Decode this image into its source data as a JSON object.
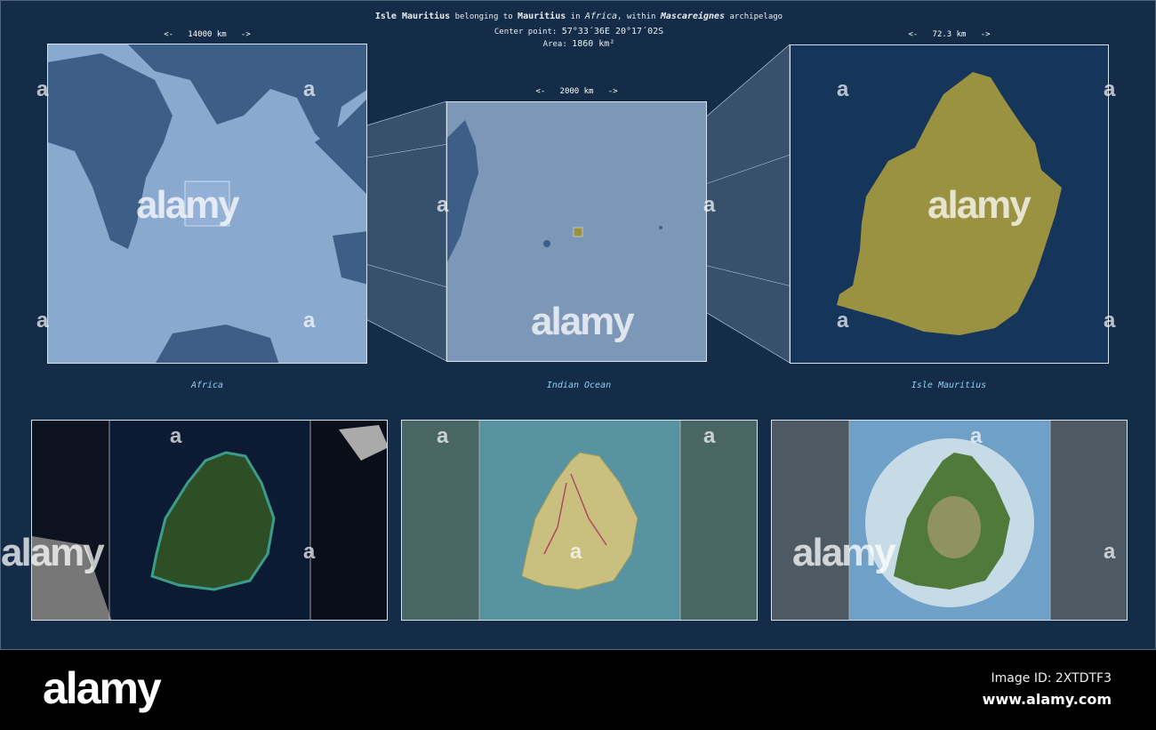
{
  "header": {
    "name": "Isle Mauritius",
    "t1": "belonging to",
    "country": "Mauritius",
    "t2": "in",
    "continent": "Africa",
    "t3": ", within",
    "archipelago": "Mascareignes",
    "t4": "archipelago",
    "center_label": "Center point:",
    "center_value": "57°33´36E  20°17´02S",
    "area_label": "Area:",
    "area_value": "1860 km²"
  },
  "panels": [
    {
      "scale": "<-   14000 km   ->",
      "caption": "Africa"
    },
    {
      "scale": "<-   2000 km   ->",
      "caption": "Indian Ocean"
    },
    {
      "scale": "<-   72.3 km   ->",
      "caption": "Isle Mauritius"
    }
  ],
  "watermark": {
    "text": "alamy",
    "letter": "a"
  },
  "footer": {
    "logo": "alamy",
    "image_id": "Image ID: 2XTDTF3",
    "site": "www.alamy.com"
  },
  "colors": {
    "bg": "#142c47",
    "land_dark": "#3d5e86",
    "sea_light": "#8aa9cf",
    "highlight": "#9a9241",
    "caption": "#8fd0f2"
  }
}
